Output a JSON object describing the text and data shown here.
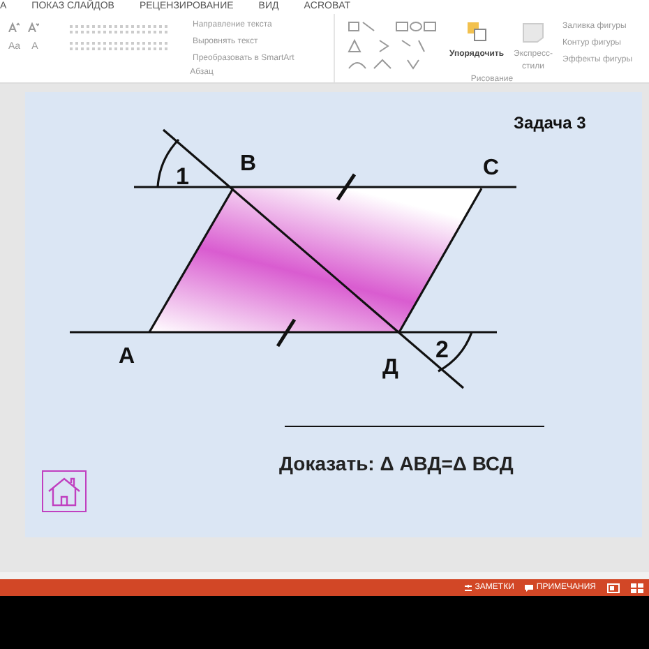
{
  "ribbon_tabs": [
    "А",
    "ПОКАЗ СЛАЙДОВ",
    "РЕЦЕНЗИРОВАНИЕ",
    "ВИД",
    "ACROBAT"
  ],
  "ribbon": {
    "paragraph_commands": [
      "Направление текста",
      "Выровнять текст",
      "Преобразовать в SmartArt"
    ],
    "font_buttons": [
      "Aa",
      "A"
    ],
    "paragraph_group": "Абзац",
    "arrange": "Упорядочить",
    "quick_styles": "Экспресс-стили",
    "shape_commands": [
      "Заливка фигуры",
      "Контур фигуры",
      "Эффекты фигуры"
    ],
    "drawing_group": "Рисование"
  },
  "slide": {
    "title": "Задача 3",
    "point_labels": [
      "1",
      "B",
      "C",
      "A",
      "Д",
      "2"
    ],
    "task": "Доказать: Δ АВД=Δ ВСД"
  },
  "status_bar": {
    "notes": "ЗАМЕТКИ",
    "comments": "ПРИМЕЧАНИЯ"
  }
}
